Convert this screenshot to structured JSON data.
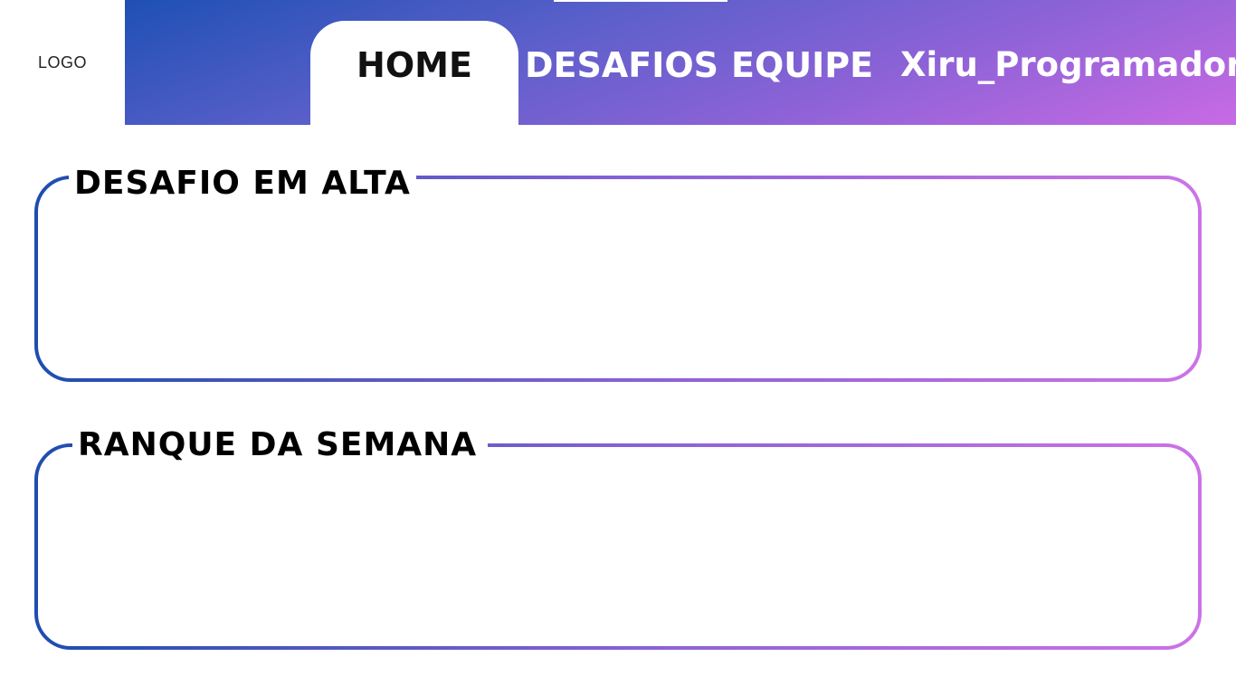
{
  "header": {
    "logo_text": "LOGO",
    "nav": {
      "home": "HOME",
      "desafios": "DESAFIOS",
      "equipe": "EQUIPE",
      "user": "Xiru_Programador"
    },
    "gradient_colors": [
      "#1e50b4",
      "#8a62d6",
      "#c86ae4"
    ]
  },
  "main": {
    "sections": [
      {
        "title": "DESAFIO EM ALTA"
      },
      {
        "title": "RANQUE DA SEMANA"
      }
    ],
    "border_gradient": [
      "#1e4db0",
      "#8e63d8",
      "#cc72e6"
    ]
  }
}
